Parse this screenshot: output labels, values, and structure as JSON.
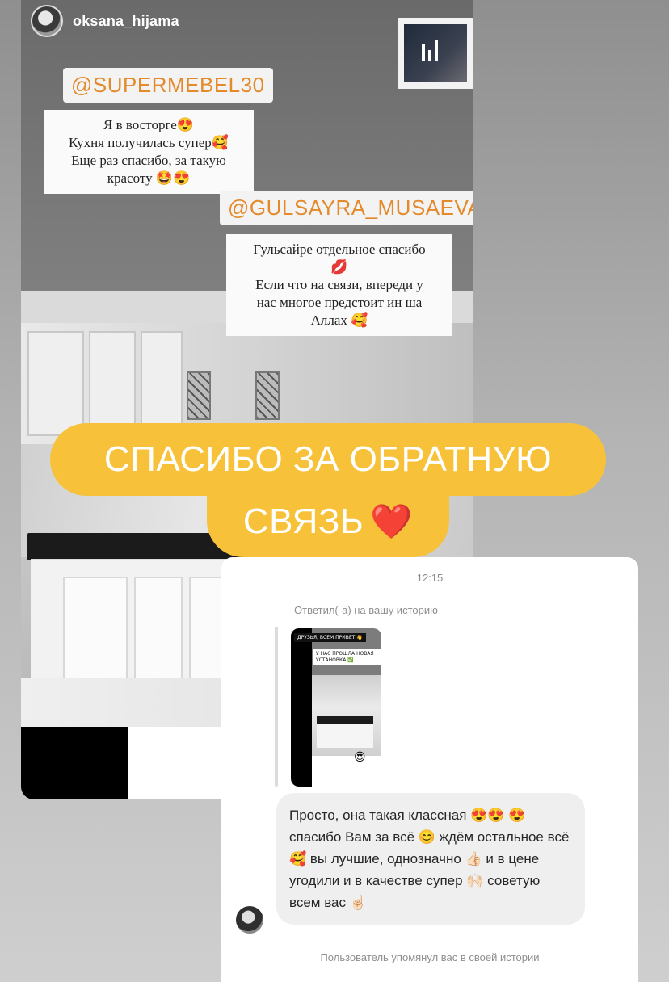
{
  "story": {
    "username": "oksana_hijama",
    "mention1": "@SUPERMEBEL30",
    "note1_lines": [
      "Я в восторге😍",
      "Кухня получилась супер🥰",
      "Еще раз спасибо, за такую",
      "красоту 🤩😍"
    ],
    "mention2": "@GULSAYRA_MUSAEVA",
    "note2_lines": [
      "Гульсайре отдельное спасибо",
      "💋",
      "Если что на связи, впереди у",
      "нас многое предстоит ин ша",
      "Аллах 🥰"
    ]
  },
  "banner": {
    "line1": "СПАСИБО ЗА ОБРАТНУЮ",
    "line2": "СВЯЗЬ",
    "heart": "❤️"
  },
  "dm": {
    "time": "12:15",
    "replied_label": "Ответил(-а) на вашу историю",
    "mini_story": {
      "tag1": "ДРУЗЬЯ, ВСЕМ ПРИВЕТ 👋",
      "tag2": "У НАС ПРОШЛА НОВАЯ УСТАНОВКА ✅",
      "emoji": "😍"
    },
    "message": "Просто, она такая классная 😍😍 😍 спасибо Вам за всё 😊 ждём остальное всё 🥰 вы лучшие, однозначно 👍🏻 и в цене угодили и в качестве супер 🙌🏻 советую всем вас ☝🏻",
    "footer": "Пользователь упомянул вас в своей истории"
  },
  "colors": {
    "banner": "#f7c23a",
    "mention_text": "#e0923a",
    "dm_bubble": "#efefef",
    "meta_text": "#8e8e8e"
  }
}
